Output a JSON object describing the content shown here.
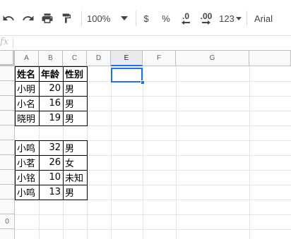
{
  "toolbar": {
    "zoom": "100%",
    "currency": "$",
    "percent": "%",
    "decrease_decimal": ".0",
    "increase_decimal": ".00",
    "more_formats": "123",
    "font": "Arial"
  },
  "formula_bar": {
    "fx": "fx"
  },
  "columns": [
    "A",
    "B",
    "C",
    "D",
    "E",
    "F",
    "G"
  ],
  "rows": [
    "",
    "",
    "",
    "",
    "",
    "",
    "",
    "",
    "",
    "",
    "0",
    ""
  ],
  "table1": {
    "header": [
      "姓名",
      "年龄",
      "性别"
    ],
    "rows": [
      [
        "小明",
        "20",
        "男"
      ],
      [
        "小名",
        "16",
        "男"
      ],
      [
        "晓明",
        "19",
        "男"
      ]
    ]
  },
  "table2": {
    "rows": [
      [
        "小鸣",
        "32",
        "男"
      ],
      [
        "小茗",
        "26",
        "女"
      ],
      [
        "小铭",
        "10",
        "未知"
      ],
      [
        "小鸣",
        "13",
        "男"
      ]
    ]
  },
  "selected_cell": "E1"
}
